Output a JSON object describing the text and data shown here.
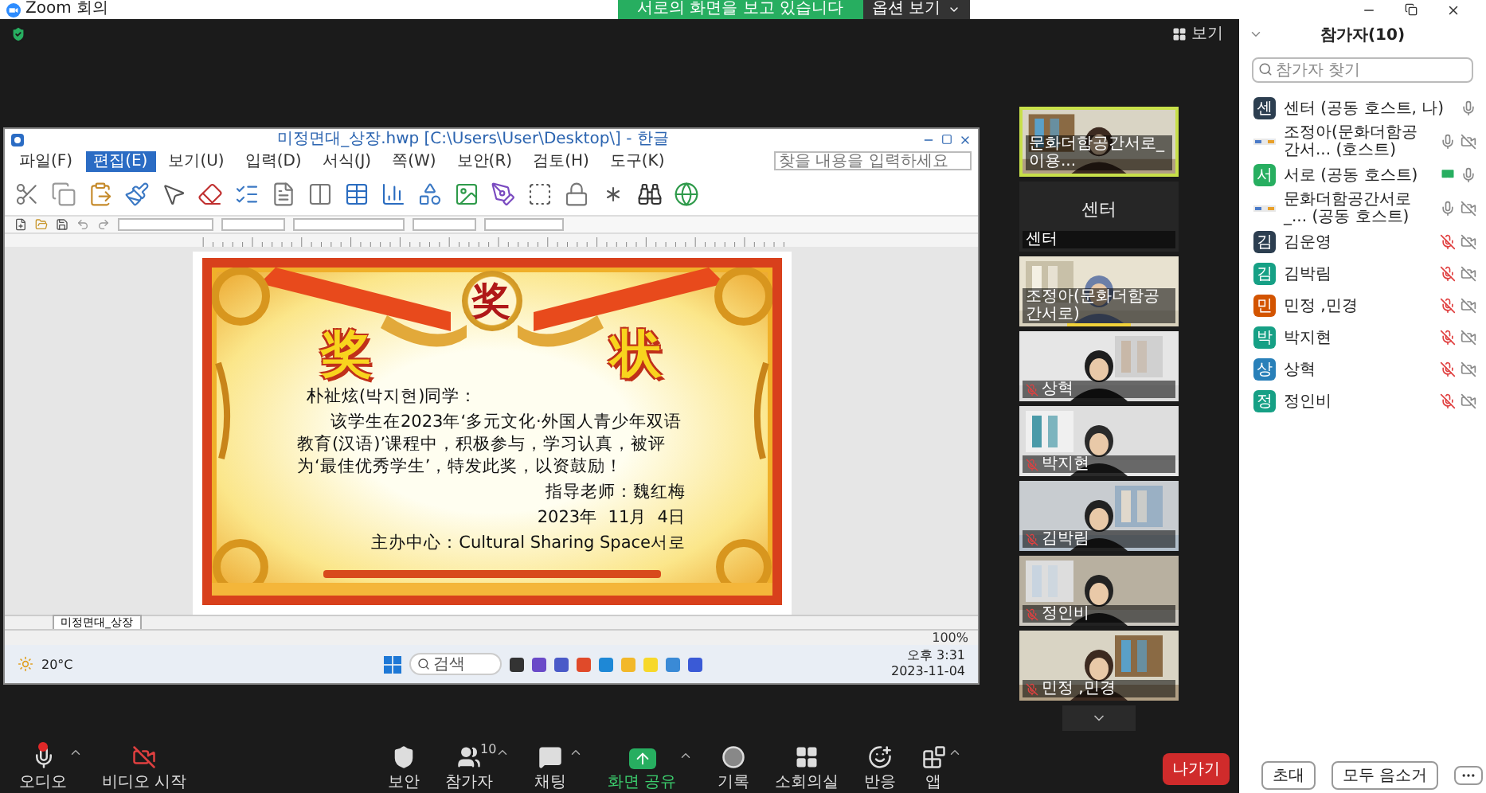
{
  "window": {
    "title": "Zoom 회의"
  },
  "share_banner": {
    "text": "서로의 화면을 보고 있습니다",
    "button": "옵션 보기"
  },
  "view_button": "보기",
  "shared_screen": {
    "title": "미정면대_상장.hwp [C:\\Users\\User\\Desktop\\] - 한글",
    "menu": [
      {
        "label": "파일(F)",
        "selected": false
      },
      {
        "label": "편집(E)",
        "selected": true
      },
      {
        "label": "보기(U)",
        "selected": false
      },
      {
        "label": "입력(D)",
        "selected": false
      },
      {
        "label": "서식(J)",
        "selected": false
      },
      {
        "label": "쪽(W)",
        "selected": false
      },
      {
        "label": "보안(R)",
        "selected": false
      },
      {
        "label": "검토(H)",
        "selected": false
      },
      {
        "label": "도구(K)",
        "selected": false
      }
    ],
    "search": {
      "placeholder": "찾을 내용을 입력하세요"
    },
    "certificate": {
      "medal": "奖",
      "heading": [
        "奖",
        "状"
      ],
      "recipient": "朴祉炫(박지현)同学：",
      "body": "该学生在2023年‘多元文化·外国人青少年双语教育(汉语)’课程中，积极参与，学习认真，被评为‘最佳优秀学生’，特发此奖，以资鼓励！",
      "signature": "指导老师：魏红梅",
      "date": "2023年  11月  4日",
      "organizer": "主办中心：Cultural Sharing Space서로"
    },
    "sheet_tab": "미정면대_상장",
    "zoom": "100%",
    "taskbar": {
      "weather": "20°C",
      "search": "검색",
      "time": "오후 3:31",
      "date": "2023-11-04"
    }
  },
  "video_tiles": [
    {
      "name": "문화더함공간서로_이용...",
      "kind": "video",
      "muted": false,
      "active": true,
      "talking": false
    },
    {
      "name": "센터",
      "display_name": "센터",
      "kind": "name_only",
      "muted": false,
      "active": false,
      "talking": false
    },
    {
      "name": "조정아(문화더함공간서로)",
      "kind": "video",
      "muted": false,
      "active": false,
      "talking": true
    },
    {
      "name": "상혁",
      "kind": "video",
      "muted": true,
      "active": false,
      "talking": false
    },
    {
      "name": "박지현",
      "kind": "video",
      "muted": true,
      "active": false,
      "talking": false
    },
    {
      "name": "김박림",
      "kind": "video",
      "muted": true,
      "active": false,
      "talking": false
    },
    {
      "name": "정인비",
      "kind": "video",
      "muted": true,
      "active": false,
      "talking": false
    },
    {
      "name": "민정 ,민경",
      "kind": "video",
      "muted": true,
      "active": false,
      "talking": false
    }
  ],
  "participants_panel": {
    "title": "참가자(10)",
    "search": {
      "placeholder": "참가자 찾기"
    },
    "participants": [
      {
        "initial": "센",
        "color": "#2c3e50",
        "name": "센터 (공동 호스트, 나)",
        "muted": false,
        "video_off": false,
        "sharing": false
      },
      {
        "name": "조정아(문화더함공간서... (호스트)",
        "muted": false,
        "video_off": true,
        "sharing": false
      },
      {
        "initial": "서",
        "color": "#27ae60",
        "name": "서로 (공동 호스트)",
        "muted": false,
        "video_off": false,
        "sharing": true
      },
      {
        "name": "문화더함공간서로_... (공동 호스트)",
        "muted": false,
        "video_off": true,
        "sharing": false
      },
      {
        "initial": "김",
        "color": "#2c3e50",
        "name": "김운영",
        "muted": true,
        "video_off": true,
        "sharing": false
      },
      {
        "initial": "김",
        "color": "#16a085",
        "name": "김박림",
        "muted": true,
        "video_off": true,
        "sharing": false
      },
      {
        "initial": "민",
        "color": "#d35400",
        "name": "민정 ,민경",
        "muted": true,
        "video_off": true,
        "sharing": false
      },
      {
        "initial": "박",
        "color": "#16a085",
        "name": "박지현",
        "muted": true,
        "video_off": true,
        "sharing": false
      },
      {
        "initial": "상",
        "color": "#2980b9",
        "name": "상혁",
        "muted": true,
        "video_off": true,
        "sharing": false
      },
      {
        "initial": "정",
        "color": "#16a085",
        "name": "정인비",
        "muted": true,
        "video_off": true,
        "sharing": false
      }
    ],
    "buttons": [
      "초대",
      "모두 음소거"
    ]
  },
  "toolbar": [
    {
      "kind": "audio",
      "label": "오디오",
      "alert": true,
      "menu": true
    },
    {
      "kind": "video",
      "label": "비디오 시작",
      "alert": false,
      "menu": false
    },
    {
      "kind": "security",
      "label": "보안",
      "alert": false,
      "menu": false
    },
    {
      "kind": "participants",
      "label": "참가자",
      "count": "10",
      "alert": false,
      "menu": true
    },
    {
      "kind": "chat",
      "label": "채팅",
      "alert": false,
      "menu": true
    },
    {
      "kind": "share",
      "label": "화면 공유",
      "alert": false,
      "menu": true
    },
    {
      "kind": "record",
      "label": "기록",
      "alert": false,
      "menu": false
    },
    {
      "kind": "breakout",
      "label": "소회의실",
      "alert": false,
      "menu": false
    },
    {
      "kind": "reactions",
      "label": "반응",
      "alert": false,
      "menu": false
    },
    {
      "kind": "apps",
      "label": "앱",
      "alert": false,
      "menu": true
    }
  ],
  "leave_button": "나가기"
}
